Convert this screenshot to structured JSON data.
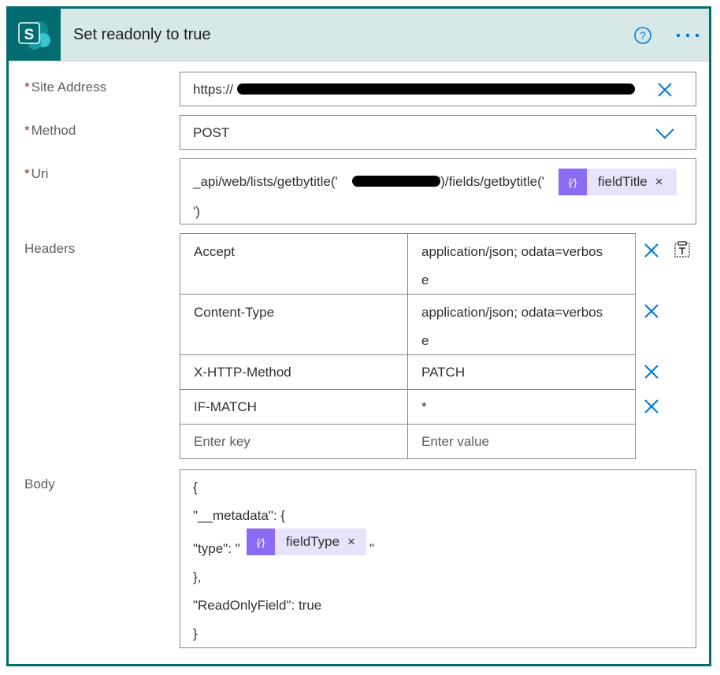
{
  "card": {
    "title": "Set readonly to true"
  },
  "icons": {
    "app": "sharepoint-icon",
    "help": "question-circle-icon",
    "more": "ellipsis-icon",
    "clear": "close-icon",
    "dropdown": "chevron-down-icon",
    "text_mode": "text-mode-icon",
    "token": "expression-icon"
  },
  "colors": {
    "accent": "#036c70",
    "header_bg": "#d7e8e9",
    "required": "#a4262c",
    "link_blue": "#0078d4",
    "token_bg": "#e8e3fb",
    "token_icon": "#8a6bf2"
  },
  "site_address": {
    "label": "Site Address",
    "required_mark": "*",
    "value": "https://"
  },
  "method": {
    "label": "Method",
    "required_mark": "*",
    "value": "POST"
  },
  "uri": {
    "label": "Uri",
    "required_mark": "*",
    "prefix": "_api/web/lists/getbytitle('",
    "middle": "')/fields/getbytitle('",
    "token_label": "fieldTitle",
    "suffix": "')",
    "token_close": "×"
  },
  "headers": {
    "label": "Headers",
    "rows": [
      {
        "key": "Accept",
        "value_line1": "application/json; odata=verbos",
        "value_line2": "e"
      },
      {
        "key": "Content-Type",
        "value_line1": "application/json; odata=verbos",
        "value_line2": "e"
      },
      {
        "key": "X-HTTP-Method",
        "value_line1": "PATCH"
      },
      {
        "key": "IF-MATCH",
        "value_line1": "*"
      }
    ],
    "key_placeholder": "Enter key",
    "value_placeholder": "Enter value"
  },
  "body": {
    "label": "Body",
    "line1": "{",
    "line2": "\"__metadata\": {",
    "line3_prefix": "\"type\": \"",
    "token_label": "fieldType",
    "token_close": "×",
    "line3_suffix": "\"",
    "line4": "},",
    "line5": "\"ReadOnlyField\": true",
    "line6": "}"
  }
}
